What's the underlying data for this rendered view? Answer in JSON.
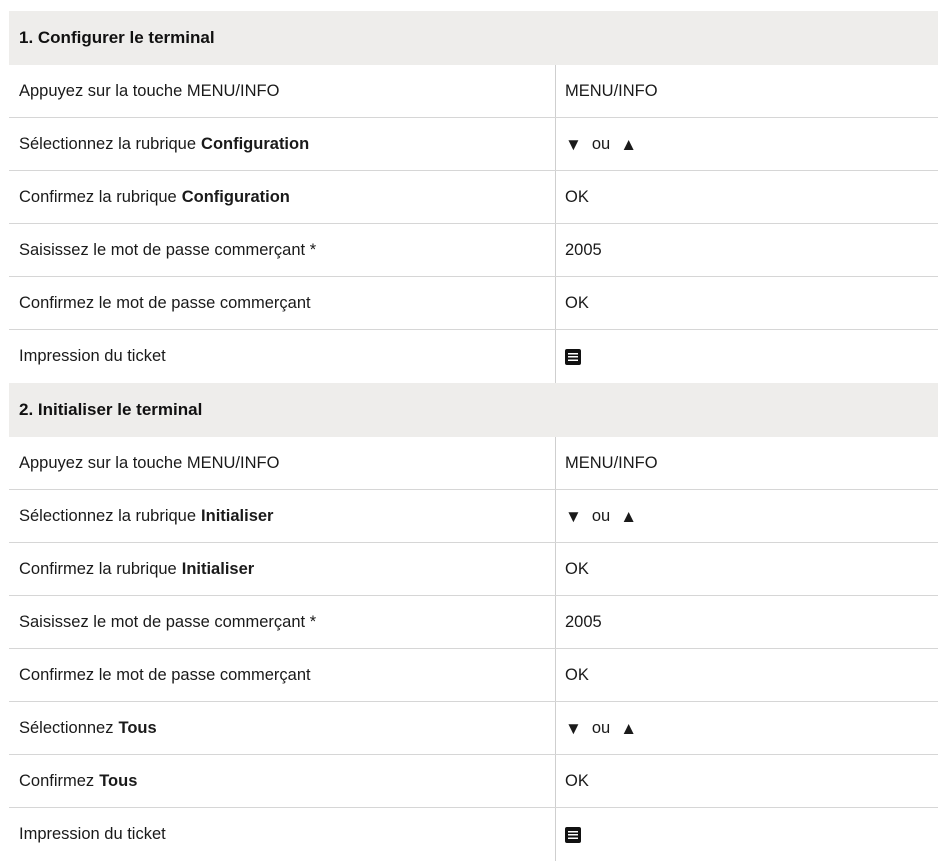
{
  "sections": [
    {
      "title": "1. Configurer le terminal",
      "steps": [
        {
          "text": "Appuyez sur la touche MENU/INFO",
          "bold": "",
          "action_type": "text",
          "action": "MENU/INFO"
        },
        {
          "text": "Sélectionnez la rubrique",
          "bold": "Configuration",
          "action_type": "arrows",
          "action": "ou"
        },
        {
          "text": "Confirmez la rubrique",
          "bold": "Configuration",
          "action_type": "text",
          "action": "OK"
        },
        {
          "text": "Saisissez le mot de passe commerçant *",
          "bold": "",
          "action_type": "text",
          "action": "2005"
        },
        {
          "text": "Confirmez le mot de passe commerçant",
          "bold": "",
          "action_type": "text",
          "action": "OK"
        },
        {
          "text": "Impression du ticket",
          "bold": "",
          "action_type": "icon",
          "icon": "ticket-print-icon"
        }
      ]
    },
    {
      "title": "2. Initialiser le terminal",
      "steps": [
        {
          "text": "Appuyez sur la touche MENU/INFO",
          "bold": "",
          "action_type": "text",
          "action": "MENU/INFO"
        },
        {
          "text": "Sélectionnez la rubrique",
          "bold": "Initialiser",
          "action_type": "arrows",
          "action": "ou"
        },
        {
          "text": "Confirmez la rubrique",
          "bold": "Initialiser",
          "action_type": "text",
          "action": "OK"
        },
        {
          "text": "Saisissez le mot de passe commerçant *",
          "bold": "",
          "action_type": "text",
          "action": "2005"
        },
        {
          "text": "Confirmez le mot de passe commerçant",
          "bold": "",
          "action_type": "text",
          "action": "OK"
        },
        {
          "text": "Sélectionnez",
          "bold": "Tous",
          "action_type": "arrows",
          "action": "ou"
        },
        {
          "text": "Confirmez",
          "bold": "Tous",
          "action_type": "text",
          "action": "OK"
        },
        {
          "text": "Impression du ticket",
          "bold": "",
          "action_type": "icon",
          "icon": "ticket-print-icon"
        }
      ]
    }
  ],
  "glyphs": {
    "down": "▼",
    "up": "▲"
  },
  "colors": {
    "header_bg": "#eeedeb",
    "text": "#1a1a1a",
    "rule": "#d6d6d6"
  }
}
